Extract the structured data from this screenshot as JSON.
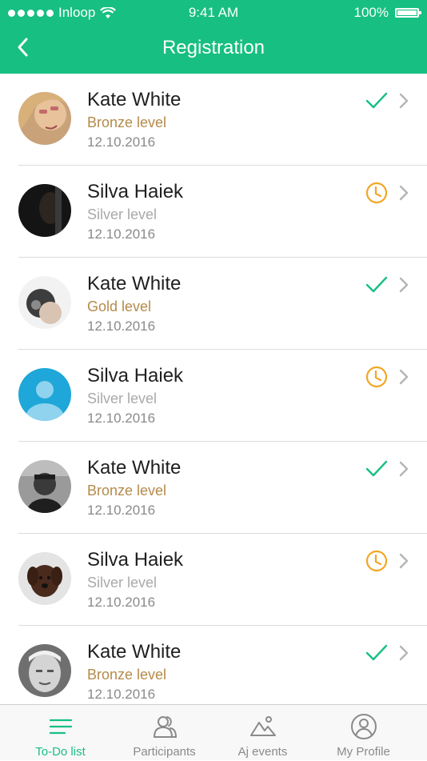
{
  "status_bar": {
    "carrier": "Inloop",
    "time": "9:41 AM",
    "battery": "100%"
  },
  "header": {
    "title": "Registration",
    "back_icon": "chevron-left-icon"
  },
  "colors": {
    "accent": "#17bf82",
    "bronze": "#b58a4a",
    "gold": "#b58a4a",
    "silver": "#a9a9a9",
    "pending": "#f2a622",
    "check": "#17bf82"
  },
  "participants": [
    {
      "name": "Kate White",
      "level": "Bronze level",
      "level_type": "bronze",
      "date": "12.10.2016",
      "status": "approved"
    },
    {
      "name": "Silva Haiek",
      "level": "Silver level",
      "level_type": "silver",
      "date": "12.10.2016",
      "status": "pending"
    },
    {
      "name": "Kate White",
      "level": "Gold level",
      "level_type": "gold",
      "date": "12.10.2016",
      "status": "approved"
    },
    {
      "name": "Silva Haiek",
      "level": "Silver level",
      "level_type": "silver",
      "date": "12.10.2016",
      "status": "pending"
    },
    {
      "name": "Kate White",
      "level": "Bronze level",
      "level_type": "bronze",
      "date": "12.10.2016",
      "status": "approved"
    },
    {
      "name": "Silva Haiek",
      "level": "Silver level",
      "level_type": "silver",
      "date": "12.10.2016",
      "status": "pending"
    },
    {
      "name": "Kate White",
      "level": "Bronze level",
      "level_type": "bronze",
      "date": "12.10.2016",
      "status": "approved"
    }
  ],
  "tabbar": {
    "tabs": [
      {
        "label": "To-Do list",
        "icon": "list-icon",
        "active": true
      },
      {
        "label": "Participants",
        "icon": "participants-icon",
        "active": false
      },
      {
        "label": "Aj events",
        "icon": "mountain-icon",
        "active": false
      },
      {
        "label": "My Profile",
        "icon": "profile-icon",
        "active": false
      }
    ]
  }
}
